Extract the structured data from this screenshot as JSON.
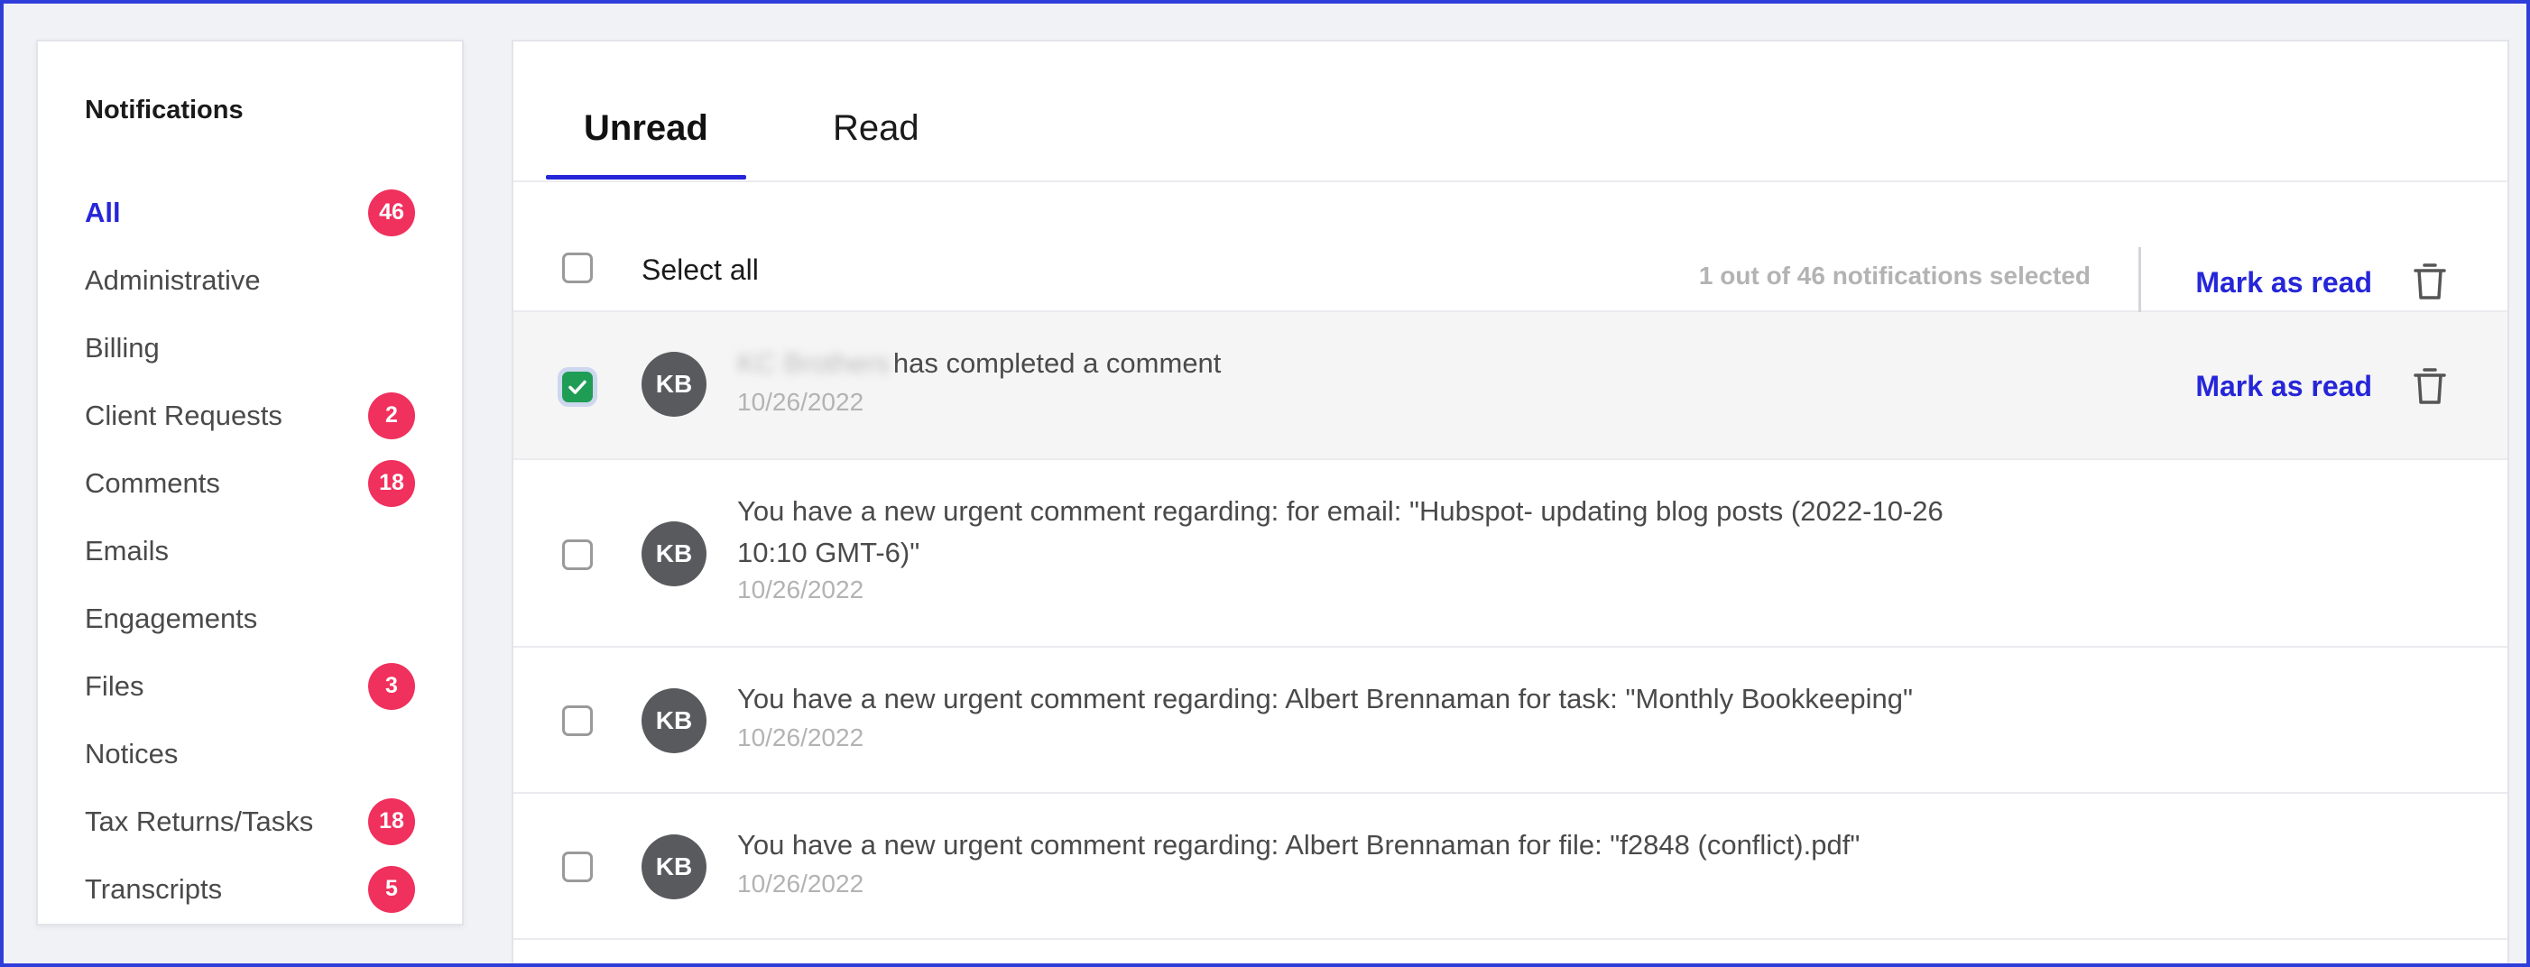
{
  "sidebar": {
    "title": "Notifications",
    "items": [
      {
        "label": "All",
        "badge": "46"
      },
      {
        "label": "Administrative",
        "badge": ""
      },
      {
        "label": "Billing",
        "badge": ""
      },
      {
        "label": "Client Requests",
        "badge": "2"
      },
      {
        "label": "Comments",
        "badge": "18"
      },
      {
        "label": "Emails",
        "badge": ""
      },
      {
        "label": "Engagements",
        "badge": ""
      },
      {
        "label": "Files",
        "badge": "3"
      },
      {
        "label": "Notices",
        "badge": ""
      },
      {
        "label": "Tax Returns/Tasks",
        "badge": "18"
      },
      {
        "label": "Transcripts",
        "badge": "5"
      }
    ]
  },
  "tabs": {
    "unread": "Unread",
    "read": "Read"
  },
  "toolbar": {
    "select_all": "Select all",
    "selected_count": "1 out of 46 notifications selected",
    "mark_as_read": "Mark as read"
  },
  "notifications": [
    {
      "avatar": "KB",
      "sender_redacted": "KC Brothers",
      "message": "has completed a comment",
      "date": "10/26/2022",
      "selected": true,
      "action": "Mark as read"
    },
    {
      "avatar": "KB",
      "message_line1": "You have a new urgent comment regarding: for email: \"Hubspot- updating blog posts (2022-10-26",
      "message_line2": "10:10 GMT-6)\"",
      "date": "10/26/2022",
      "selected": false
    },
    {
      "avatar": "KB",
      "message": "You have a new urgent comment regarding: Albert Brennaman for task: \"Monthly Bookkeeping\"",
      "date": "10/26/2022",
      "selected": false
    },
    {
      "avatar": "KB",
      "message": "You have a new urgent comment regarding: Albert Brennaman for file: \"f2848 (conflict).pdf\"",
      "date": "10/26/2022",
      "selected": false
    }
  ],
  "colors": {
    "accent": "#2626d9",
    "badge": "#f0305d",
    "checked": "#1f9d55",
    "frame": "#2f3ed8"
  }
}
